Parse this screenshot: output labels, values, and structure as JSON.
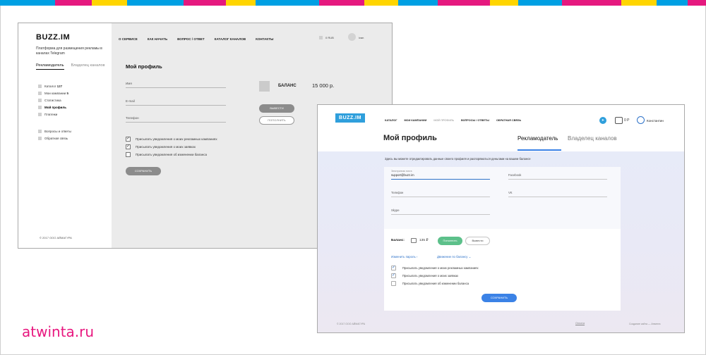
{
  "colors": {
    "stripes": [
      "#00a0e3",
      "#e5197f",
      "#ffd500"
    ],
    "brand": "#e8177f",
    "accent_blue": "#3b82e6",
    "green": "#5cc08a"
  },
  "wireframe": {
    "logo": "BUZZ.IM",
    "tagline": "Платформа для размещения рекламы в каналах Telegram",
    "tabs": [
      "Рекламодатель",
      "Владелец каналов"
    ],
    "menu": [
      {
        "label": "Каталог",
        "count": "127"
      },
      {
        "label": "Мои кампании",
        "count": "5"
      },
      {
        "label": "Статистика",
        "count": ""
      },
      {
        "label": "Мой профиль",
        "count": ""
      },
      {
        "label": "Платежи",
        "count": ""
      }
    ],
    "menu2": [
      "Вопросы и ответы",
      "Обратная связь"
    ],
    "copyright": "© 2017 ООО АЙМАГУРА",
    "nav": [
      "О СЕРВИСЕ",
      "КАК НАЧАТЬ",
      "ВОПРОС / ОТВЕТ",
      "КАТАЛОГ КАНАЛОВ",
      "КОНТАКТЫ"
    ],
    "currency": "0 RUB",
    "user": "ivan",
    "title": "Мой профиль",
    "fields": [
      "Имя",
      "E-mail",
      "Телефон"
    ],
    "checks": [
      {
        "label": "Присылать уведомления о моих рекламных кампаниях",
        "checked": true
      },
      {
        "label": "Присылать уведомления о моих заявках",
        "checked": true
      },
      {
        "label": "Присылать уведомления об изменении баланса",
        "checked": false
      }
    ],
    "save": "СОХРАНИТЬ",
    "balance_label": "БАЛАНС",
    "balance_value": "15 000 р.",
    "withdraw": "ВЫВЕСТИ",
    "topup": "ПОПОЛНИТЬ"
  },
  "screen": {
    "logo": "BUZZ.IM",
    "nav": [
      "КАТАЛОГ",
      "МОИ КАМПАНИИ",
      "МОЙ ПРОФИЛЬ",
      "ВОПРОСЫ / ОТВЕТЫ",
      "ОБРАТНАЯ СВЯЗЬ"
    ],
    "balance": "0 Р",
    "user": "Константин",
    "title": "Мой профиль",
    "tab_active": "Рекламодатель",
    "tab_other": "Владелец каналов",
    "intro": "Здесь вы можете отредактировать данные своего профиля и распоряжаться деньгами на вашем балансе",
    "email_label": "Электронная почта",
    "email_value": "support@buzz.im",
    "phone": "Телефон",
    "skype": "Skype",
    "facebook": "Facebook",
    "vk": "VK",
    "balance_label": "Баланс:",
    "balance_value": "135 ₽",
    "topup": "Пополнить",
    "withdraw": "Вывести",
    "change_password": "Изменить пароль ›",
    "balance_movement": "Движение по балансу ⌄",
    "checks": [
      {
        "label": "Присылать уведомления о моих рекламных кампаниях",
        "checked": true
      },
      {
        "label": "Присылать уведомления о моих заявках",
        "checked": true
      },
      {
        "label": "Присылать уведомления об изменении баланса",
        "checked": false
      }
    ],
    "save": "СОХРАНИТЬ",
    "footer_left": "© 2017 ООО АЙМАГУРА",
    "footer_center": "Оплата",
    "footer_right": "Создание сайта — Атвинта"
  },
  "brand_text": "atwinta.ru"
}
